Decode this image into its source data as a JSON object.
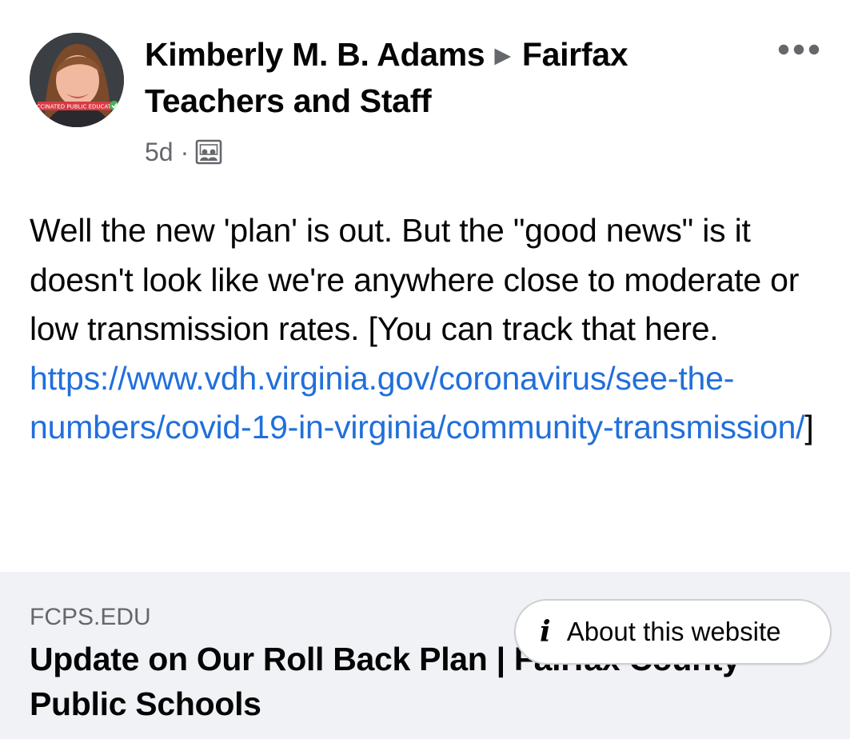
{
  "post": {
    "author": "Kimberly M. B. Adams",
    "group": "Fairfax Teachers and Staff",
    "time": "5d",
    "separator": "·",
    "audience_icon": "photo-icon",
    "avatar_badge_text": "VACCINATED PUBLIC EDUCATOR",
    "more_icon": "more-horizontal-icon",
    "body_text": "Well the new 'plan' is out. But the \"good news\" is it doesn't look like we're anywhere close to moderate or low transmission rates. [You can track that here.",
    "link_text": "https://www.vdh.virginia.gov/coronavirus/see-the-numbers/covid-19-in-virginia/community-transmission/",
    "closing_bracket": "]"
  },
  "link_preview": {
    "domain": "FCPS.EDU",
    "title": "Update on Our Roll Back Plan | Fairfax County Public Schools"
  },
  "about_website": {
    "label": "About this website",
    "icon": "info-icon"
  },
  "colors": {
    "link": "#216fdb",
    "secondary_text": "#65676b",
    "preview_background": "#f0f2f5"
  }
}
